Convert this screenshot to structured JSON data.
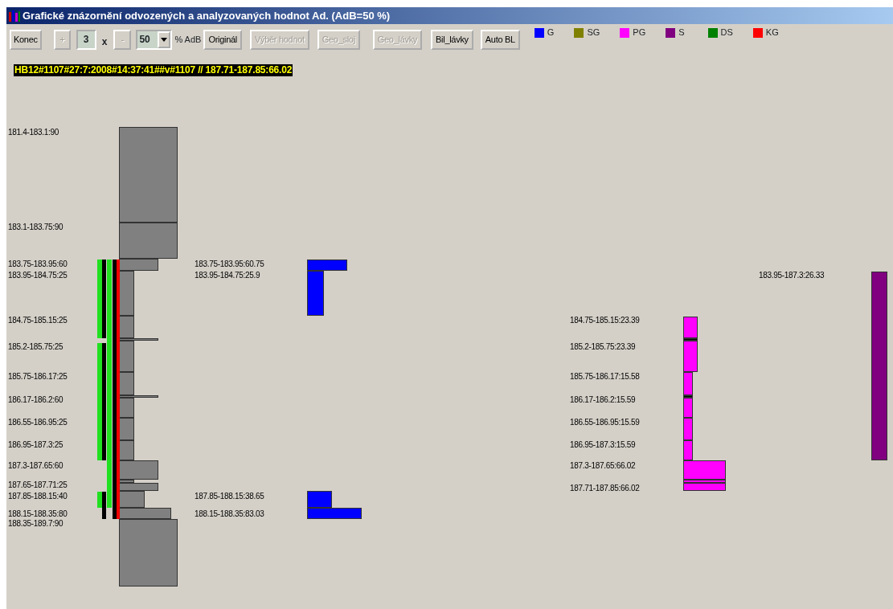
{
  "window": {
    "title": "Grafické znázornění odvozených a analyzovaných hodnot Ad.  (AdB=50 %)"
  },
  "toolbar": {
    "buttons": [
      {
        "label": "Konec",
        "disabled": false
      },
      {
        "label": "+",
        "disabled": true
      }
    ],
    "zoom_value": "3",
    "zoom_unit": "x",
    "minus_button": {
      "label": "-",
      "disabled": true
    },
    "adb_select": {
      "value": "50",
      "unit": "% AdB"
    },
    "more_buttons": [
      {
        "label": "Originál",
        "disabled": false
      },
      {
        "label": "Výběr hodnot",
        "disabled": true
      },
      {
        "label": "Geo_sloj",
        "disabled": true
      },
      {
        "label": "Geo_lávky",
        "disabled": true
      },
      {
        "label": "Bil_lávky",
        "disabled": false
      },
      {
        "label": "Auto BL",
        "disabled": false
      }
    ]
  },
  "legend": [
    {
      "label": "G",
      "color": "#0000ff"
    },
    {
      "label": "SG",
      "color": "#808000"
    },
    {
      "label": "PG",
      "color": "#ff00ff"
    },
    {
      "label": "S",
      "color": "#800080"
    },
    {
      "label": "DS",
      "color": "#008000"
    },
    {
      "label": "KG",
      "color": "#ff0000"
    }
  ],
  "record_header": "HB12#1107#27:7:2008#14:37:41##v#1107 // 187.71-187.85:66.02",
  "profile_labels": [
    "181.4-183.1:90",
    "183.1-183.75:90",
    "183.75-183.95:60",
    "183.95-184.75:25",
    "184.75-185.15:25",
    "185.2-185.75:25",
    "185.75-186.17:25",
    "186.17-186.2:60",
    "186.55-186.95:25",
    "186.95-187.3:25",
    "187.3-187.65:60",
    "187.65-187.71:25",
    "187.85-188.15:40",
    "188.15-188.35:80",
    "188.35-189.7:90"
  ],
  "groups": [
    {
      "color": "#0000ff",
      "labels": [
        "183.75-183.95:60.75",
        "183.95-184.75:25.9",
        "187.85-188.15:38.65",
        "188.15-188.35:83.03"
      ]
    },
    {
      "color": "#ff00ff",
      "labels": [
        "184.75-185.15:23.39",
        "185.2-185.75:23.39",
        "185.75-186.17:15.58",
        "186.17-186.2:15.59",
        "186.55-186.95:15.59",
        "186.95-187.3:15.59",
        "187.3-187.65:66.02",
        "187.71-187.85:66.02"
      ]
    },
    {
      "color": "#800080",
      "labels": [
        "183.95-187.3:26.33"
      ]
    }
  ]
}
